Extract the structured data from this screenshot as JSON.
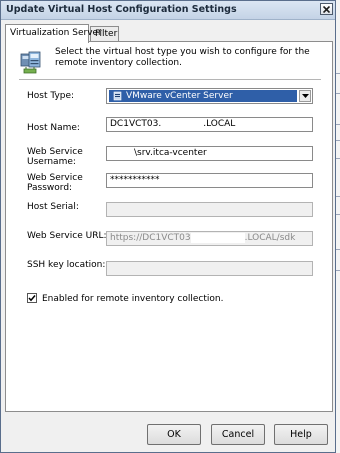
{
  "window": {
    "title": "Update Virtual Host Configuration Settings"
  },
  "tabs": [
    {
      "label": "Virtualization Server",
      "active": true
    },
    {
      "label": "Filter",
      "active": false
    }
  ],
  "intro": {
    "text": "Select the virtual host type you wish to configure for the remote inventory collection.",
    "icon": "network-computer-icon"
  },
  "fields": {
    "host_type": {
      "label": "Host Type:",
      "value": "VMware vCenter Server"
    },
    "host_name": {
      "label": "Host Name:",
      "value_prefix": "DC1VCT03.",
      "value_suffix": ".LOCAL"
    },
    "ws_username": {
      "label_line1": "Web Service",
      "label_line2": "Username:",
      "value": "\\srv.itca-vcenter"
    },
    "ws_password": {
      "label_line1": "Web Service",
      "label_line2": "Password:",
      "value": "***********"
    },
    "host_serial": {
      "label": "Host Serial:",
      "value": ""
    },
    "ws_url": {
      "label": "Web Service URL:",
      "value_prefix": "https://DC1VCT03",
      "value_suffix": ".LOCAL/sdk"
    },
    "ssh_key": {
      "label": "SSH key location:",
      "value": ""
    }
  },
  "checkbox": {
    "label": "Enabled for remote inventory collection.",
    "checked": true
  },
  "buttons": {
    "ok": "OK",
    "cancel": "Cancel",
    "help": "Help"
  },
  "colors": {
    "selection": "#2f5fa8",
    "titlebar": "#c4d3e6"
  }
}
